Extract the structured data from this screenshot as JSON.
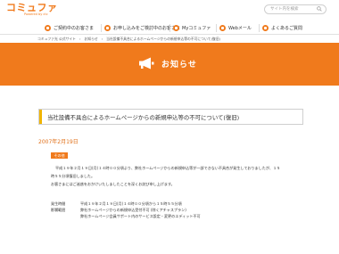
{
  "header": {
    "logo_main": "コミュファ",
    "logo_sub": "Powered by ctc",
    "search_placeholder": "サイト内を検索"
  },
  "nav": {
    "items": [
      {
        "label": "ご契約中のお客さま"
      },
      {
        "label": "お申し込みをご検討中のお客さま"
      },
      {
        "label": "Myコミュファ"
      },
      {
        "label": "Webメール"
      },
      {
        "label": "よくあるご質問"
      }
    ]
  },
  "breadcrumb": {
    "items": [
      "コミュファ光 公式サイト",
      "お知らせ",
      "当社設備不具合によるホームページからの新規申込等の不可について(復旧)"
    ]
  },
  "banner": {
    "title": "お知らせ"
  },
  "article": {
    "title": "当社設備不具合によるホームページからの新規申込等の不可について(復旧)",
    "date": "2007年2月19日",
    "tag": "その他",
    "paragraph_lines": [
      "平成１９年２月１９日(月)１４時００分頃より、弊社ホームページからの新規申込等が一部できない不具合が発生しておりましたが、１５",
      "時５５分頃復旧しました。",
      "お客さまにはご迷惑をおかけいたしましたことを深くお詫び申し上げます。"
    ],
    "details": [
      {
        "label": "発生時間",
        "value": "平成１９年２月１９日(月)１４時００分頃から１５時５５分頃"
      },
      {
        "label": "影響範囲",
        "value": "弊社ホームページからの新規申込受付不可 (除くアチャスプラン)"
      },
      {
        "label": "",
        "value": "弊社ホームページ会員サポート内のサービス設定・変更のエディット不可"
      }
    ]
  },
  "colors": {
    "brand": "#f07a1c",
    "title_accent": "#f0b400"
  }
}
